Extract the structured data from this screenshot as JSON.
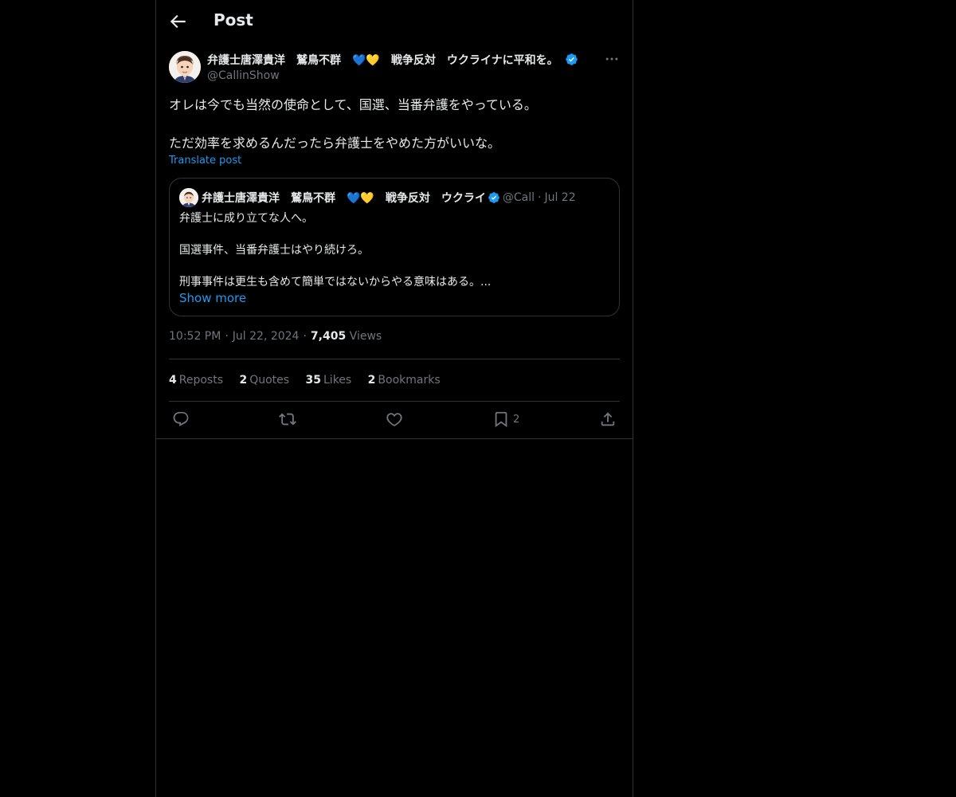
{
  "header": {
    "title": "Post"
  },
  "tweet": {
    "author": {
      "display_name": "弁護士唐澤貴洋　鷲鳥不群　💙💛　戦争反対　ウクライナに平和を。",
      "handle": "@CallinShow",
      "verified": true,
      "verified_color": "#1d9bf0"
    },
    "text_lines": [
      "オレは今でも当然の使命として、国選、当番弁護をやっている。",
      "ただ効率を求めるんだったら弁護士をやめた方がいいな。"
    ],
    "translate_label": "Translate post",
    "quote": {
      "display_name": "弁護士唐澤貴洋　鷲鳥不群　💙💛　戦争反対　ウクライ",
      "handle": "@Call",
      "dot": "·",
      "date": "Jul 22",
      "lines": [
        "弁護士に成り立てな人へ。",
        "国選事件、当番弁護士はやり続けろ。",
        "刑事事件は更生も含めて簡単ではないからやる意味はある。..."
      ],
      "show_more": "Show more"
    },
    "meta": {
      "time": "10:52 PM",
      "sep": "·",
      "date": "Jul 22, 2024",
      "views_count": "7,405",
      "views_label": "Views"
    },
    "stats": {
      "reposts_count": "4",
      "reposts_label": "Reposts",
      "quotes_count": "2",
      "quotes_label": "Quotes",
      "likes_count": "35",
      "likes_label": "Likes",
      "bookmarks_count": "2",
      "bookmarks_label": "Bookmarks"
    },
    "actions": {
      "reply_icon": "reply-icon",
      "repost_icon": "repost-icon",
      "like_icon": "heart-icon",
      "bookmark_icon": "bookmark-icon",
      "bookmark_count": "2",
      "share_icon": "share-icon"
    }
  },
  "colors": {
    "background": "#000000",
    "text": "#e7e9ea",
    "secondary": "#71767b",
    "accent": "#1d9bf0",
    "border": "#2f3336"
  }
}
